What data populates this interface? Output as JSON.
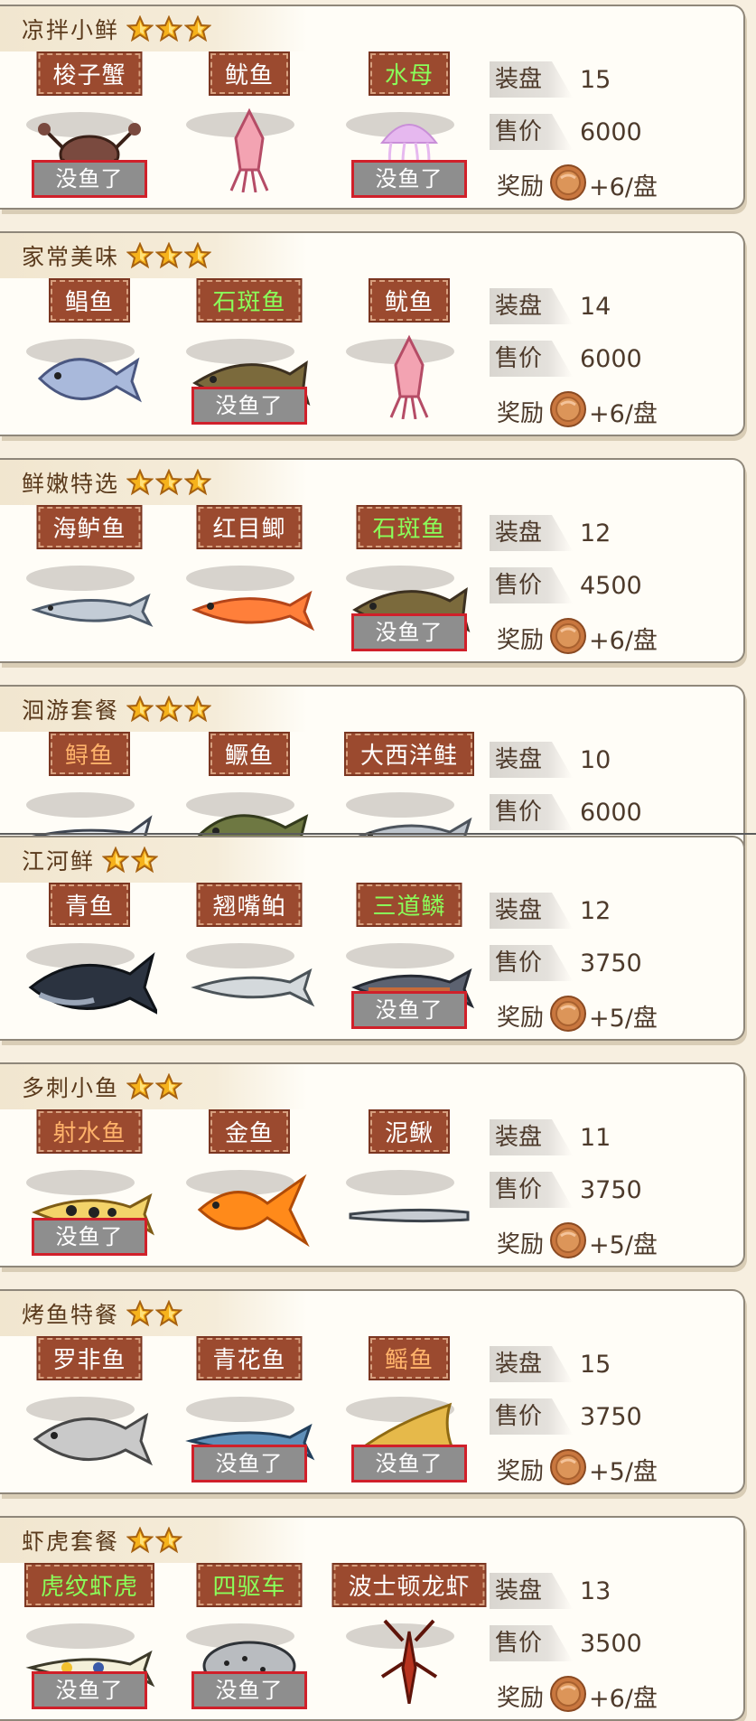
{
  "labels": {
    "plates": "装盘",
    "price": "售价",
    "reward": "奖励",
    "no_fish": "没鱼了"
  },
  "sets": [
    {
      "title": "凉拌小鲜",
      "stars": 3,
      "plates": "15",
      "price": "6000",
      "reward": "+6/盘",
      "items": [
        {
          "name": "梭子蟹",
          "color": "white",
          "sold_out": true,
          "icon": "crab"
        },
        {
          "name": "鱿鱼",
          "color": "white",
          "sold_out": false,
          "icon": "squid"
        },
        {
          "name": "水母",
          "color": "green",
          "sold_out": true,
          "icon": "jellyfish"
        }
      ]
    },
    {
      "title": "家常美味",
      "stars": 3,
      "plates": "14",
      "price": "6000",
      "reward": "+6/盘",
      "items": [
        {
          "name": "鲳鱼",
          "color": "white",
          "sold_out": false,
          "icon": "pomfret"
        },
        {
          "name": "石斑鱼",
          "color": "green",
          "sold_out": true,
          "icon": "grouper"
        },
        {
          "name": "鱿鱼",
          "color": "white",
          "sold_out": false,
          "icon": "squid"
        }
      ]
    },
    {
      "title": "鲜嫩特选",
      "stars": 3,
      "plates": "12",
      "price": "4500",
      "reward": "+6/盘",
      "items": [
        {
          "name": "海鲈鱼",
          "color": "white",
          "sold_out": false,
          "icon": "bass"
        },
        {
          "name": "红目鲫",
          "color": "white",
          "sold_out": false,
          "icon": "redfish"
        },
        {
          "name": "石斑鱼",
          "color": "green",
          "sold_out": true,
          "icon": "grouper"
        }
      ]
    },
    {
      "title": "洄游套餐",
      "stars": 3,
      "plates": "10",
      "price": "6000",
      "reward": "",
      "items": [
        {
          "name": "鲟鱼",
          "color": "orange",
          "sold_out": false,
          "icon": "sturgeon"
        },
        {
          "name": "鳜鱼",
          "color": "white",
          "sold_out": false,
          "icon": "mandarinfish"
        },
        {
          "name": "大西洋鲑",
          "color": "white",
          "sold_out": false,
          "icon": "salmon"
        }
      ]
    },
    {
      "title": "江河鲜",
      "stars": 2,
      "plates": "12",
      "price": "3750",
      "reward": "+5/盘",
      "items": [
        {
          "name": "青鱼",
          "color": "white",
          "sold_out": false,
          "icon": "blackcarp"
        },
        {
          "name": "翘嘴鲌",
          "color": "white",
          "sold_out": false,
          "icon": "topmouth"
        },
        {
          "name": "三道鳞",
          "color": "green",
          "sold_out": true,
          "icon": "carp"
        }
      ]
    },
    {
      "title": "多刺小鱼",
      "stars": 2,
      "plates": "11",
      "price": "3750",
      "reward": "+5/盘",
      "items": [
        {
          "name": "射水鱼",
          "color": "orange",
          "sold_out": true,
          "icon": "archerfish"
        },
        {
          "name": "金鱼",
          "color": "white",
          "sold_out": false,
          "icon": "goldfish"
        },
        {
          "name": "泥鳅",
          "color": "white",
          "sold_out": false,
          "icon": "loach"
        }
      ]
    },
    {
      "title": "烤鱼特餐",
      "stars": 2,
      "plates": "15",
      "price": "3750",
      "reward": "+5/盘",
      "items": [
        {
          "name": "罗非鱼",
          "color": "white",
          "sold_out": false,
          "icon": "tilapia"
        },
        {
          "name": "青花鱼",
          "color": "white",
          "sold_out": true,
          "icon": "mackerel"
        },
        {
          "name": "鳐鱼",
          "color": "orange",
          "sold_out": true,
          "icon": "ray"
        }
      ]
    },
    {
      "title": "虾虎套餐",
      "stars": 2,
      "plates": "13",
      "price": "3500",
      "reward": "+6/盘",
      "items": [
        {
          "name": "虎纹虾虎",
          "color": "green",
          "sold_out": true,
          "icon": "goby"
        },
        {
          "name": "四驱车",
          "color": "green",
          "sold_out": true,
          "icon": "pufferfish"
        },
        {
          "name": "波士顿龙虾",
          "color": "white",
          "sold_out": false,
          "icon": "lobster"
        }
      ]
    }
  ]
}
